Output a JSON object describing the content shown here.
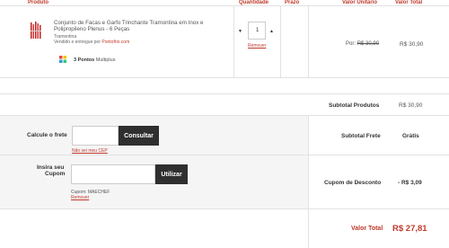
{
  "headers": {
    "produto": "Produto",
    "quantidade": "Quantidade",
    "prazo": "Prazo",
    "valor_unitario": "Valor Unitário",
    "valor_total": "Valor Total"
  },
  "item": {
    "name_line1": "Conjunto de Facas e Garfo Trinchante Tramontina em Inox e",
    "name_line2": "Polipropileno Plenus - 6 Peças",
    "brand": "Tramontina",
    "seller_prefix": "Vendido e entregue por",
    "seller": "Pontofrio.com",
    "points": "3 Pontos",
    "points_program": "Multiplus",
    "quantity": "1",
    "remove": "Remover",
    "unit_price_label": "Por:",
    "unit_price": "R$ 30,90",
    "total_price": "R$ 30,90"
  },
  "subtotal": {
    "label": "Subtotal Produtos",
    "value": "R$ 30,90"
  },
  "frete": {
    "label": "Calcule o frete",
    "button": "Consultar",
    "link": "Não sei meu CEP",
    "subtotal_label": "Subtotal Frete",
    "subtotal_value": "Grátis"
  },
  "cupom": {
    "label_line1": "Insira seu",
    "label_line2": "Cupom",
    "button": "Utilizar",
    "applied": "Cupom: MAECHEF",
    "remove": "Remover",
    "desconto_label": "Cupom de Desconto",
    "desconto_value": "- R$ 3,09"
  },
  "total": {
    "label": "Valor Total",
    "value": "R$ 27,81"
  }
}
